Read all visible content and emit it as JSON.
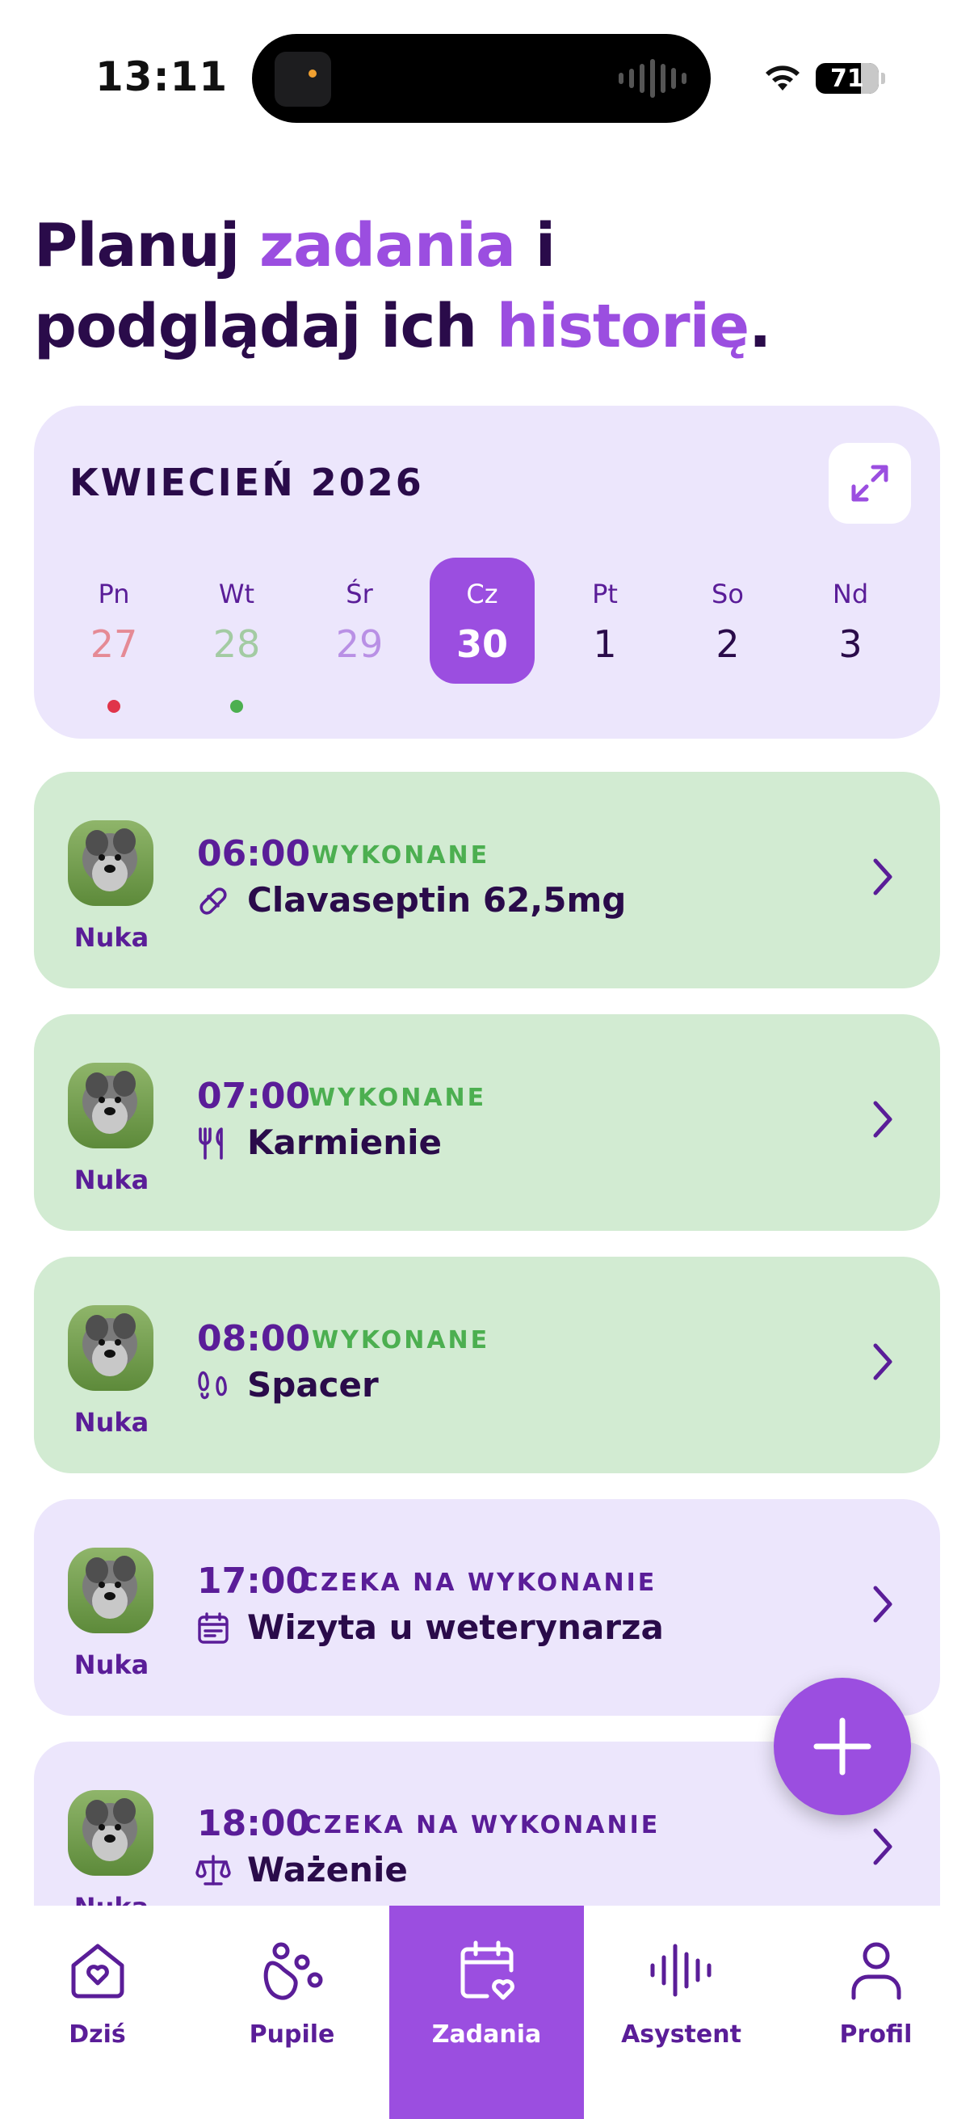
{
  "status_bar": {
    "time": "13:11",
    "battery": "71"
  },
  "headline": {
    "part1": "Planuj ",
    "accent1": "zadania",
    "part2": " i",
    "part3": "podglądaj ich ",
    "accent2": "historię",
    "part4": "."
  },
  "calendar": {
    "month_label": "KWIECIEŃ 2026",
    "days": [
      {
        "name": "Pn",
        "num": "27",
        "state": "past",
        "marker": "missed"
      },
      {
        "name": "Wt",
        "num": "28",
        "state": "past",
        "marker": "done"
      },
      {
        "name": "Śr",
        "num": "29",
        "state": "past",
        "marker": ""
      },
      {
        "name": "Cz",
        "num": "30",
        "state": "selected",
        "marker": ""
      },
      {
        "name": "Pt",
        "num": "1",
        "state": "future",
        "marker": ""
      },
      {
        "name": "So",
        "num": "2",
        "state": "future",
        "marker": ""
      },
      {
        "name": "Nd",
        "num": "3",
        "state": "future",
        "marker": ""
      }
    ]
  },
  "tasks": [
    {
      "pet": "Nuka",
      "time": "06:00",
      "status": "WYKONANE",
      "title": "Clavaseptin 62,5mg",
      "icon": "pill-icon",
      "state": "done"
    },
    {
      "pet": "Nuka",
      "time": "07:00",
      "status": "WYKONANE",
      "title": "Karmienie",
      "icon": "fork-knife-icon",
      "state": "done"
    },
    {
      "pet": "Nuka",
      "time": "08:00",
      "status": "WYKONANE",
      "title": "Spacer",
      "icon": "paw-walk-icon",
      "state": "done"
    },
    {
      "pet": "Nuka",
      "time": "17:00",
      "status": "CZEKA NA WYKONANIE",
      "title": "Wizyta u weterynarza",
      "icon": "calendar-icon",
      "state": "pending"
    },
    {
      "pet": "Nuka",
      "time": "18:00",
      "status": "CZEKA NA WYKONANIE",
      "title": "Ważenie",
      "icon": "scale-icon",
      "state": "pending"
    }
  ],
  "nav": [
    {
      "label": "Dziś",
      "icon": "home-heart-icon",
      "active": false
    },
    {
      "label": "Pupile",
      "icon": "paw-icon",
      "active": false
    },
    {
      "label": "Zadania",
      "icon": "calendar-heart-icon",
      "active": true
    },
    {
      "label": "Asystent",
      "icon": "voice-wave-icon",
      "active": false
    },
    {
      "label": "Profil",
      "icon": "person-icon",
      "active": false
    }
  ],
  "colors": {
    "accent": "#9b4ee0",
    "dark": "#2a0b4a",
    "done_bg": "#d2ebd2",
    "pending_bg": "#ece6fc",
    "done_status": "#4caf50",
    "missed_dot": "#e0344a"
  }
}
